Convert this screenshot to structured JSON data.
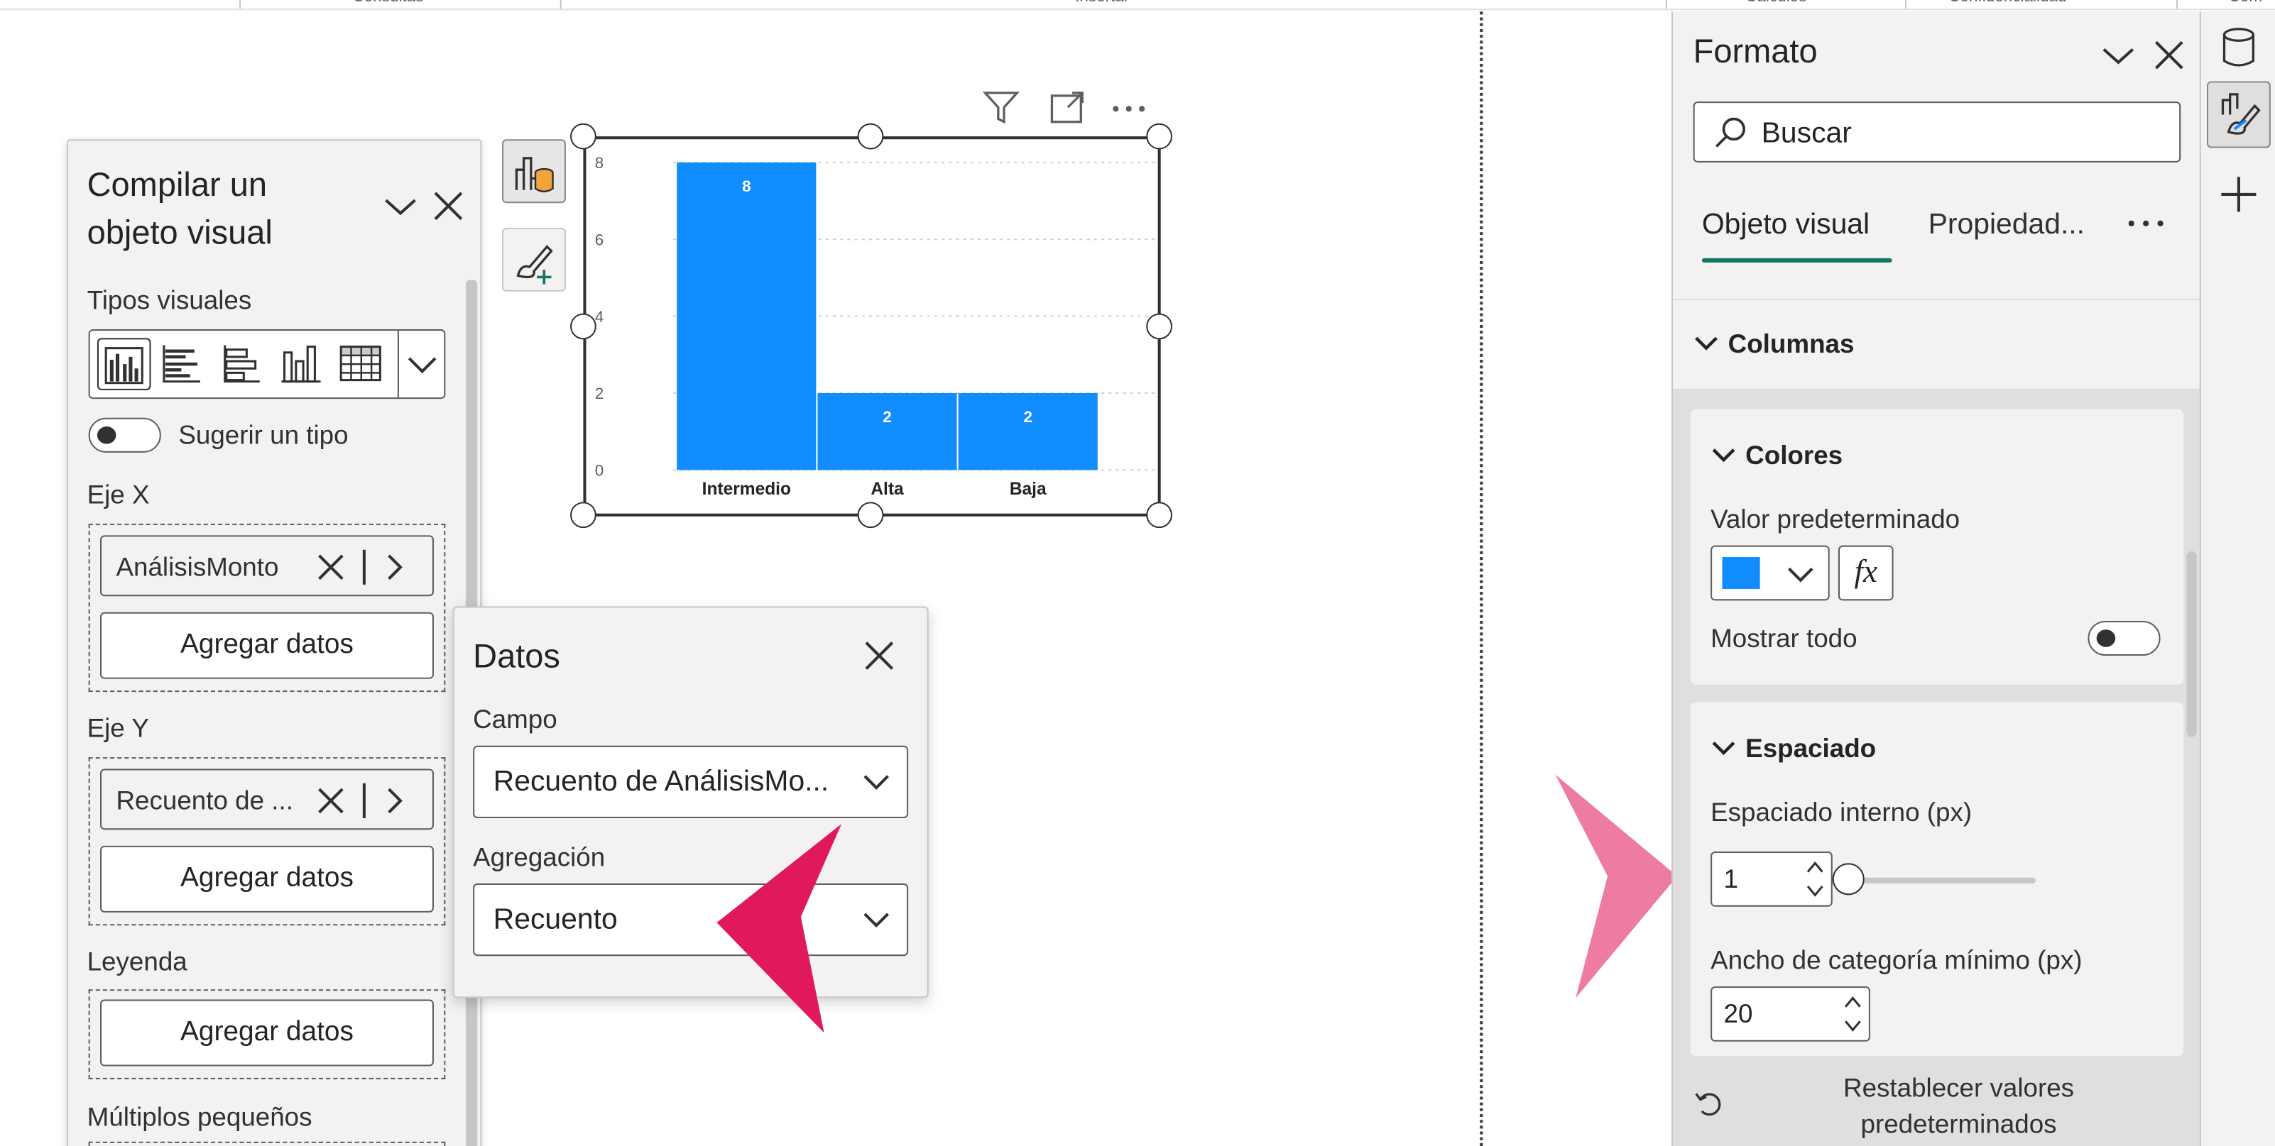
{
  "ribbon": {
    "groups": [
      "Consultas",
      "Insertar",
      "Cálculos",
      "Confidencialidad",
      "Com"
    ]
  },
  "build_pane": {
    "title": "Compilar un objeto visual",
    "visual_types_label": "Tipos visuales",
    "visual_type_icons": [
      "clustered-column-chart-icon",
      "clustered-bar-chart-icon",
      "stacked-bar-chart-icon",
      "column-chart-icon",
      "table-icon"
    ],
    "suggest_label": "Sugerir un tipo",
    "x_axis_label": "Eje X",
    "x_axis_field": "AnálisisMonto",
    "y_axis_label": "Eje Y",
    "y_axis_field": "Recuento de ...",
    "legend_label": "Leyenda",
    "small_multiples_label": "Múltiplos pequeños",
    "add_data_label": "Agregar datos"
  },
  "chart_data": {
    "type": "bar",
    "categories": [
      "Intermedio",
      "Alta",
      "Baja"
    ],
    "values": [
      8,
      2,
      2
    ],
    "ylim": [
      0,
      8
    ],
    "yticks": [
      0,
      2,
      4,
      6,
      8
    ],
    "color": "#118DFF",
    "grid": true,
    "data_labels": true
  },
  "data_popup": {
    "title": "Datos",
    "field_label": "Campo",
    "field_value": "Recuento de AnálisisMo...",
    "aggregation_label": "Agregación",
    "aggregation_value": "Recuento"
  },
  "format_pane": {
    "title": "Formato",
    "search_placeholder": "Buscar",
    "tab_visual": "Objeto visual",
    "tab_properties": "Propiedad...",
    "section_columns": "Columnas",
    "colors_header": "Colores",
    "default_value_label": "Valor predeterminado",
    "default_color": "#118DFF",
    "fx_label": "fx",
    "show_all_label": "Mostrar todo",
    "spacing_header": "Espaciado",
    "inner_padding_label": "Espaciado interno (px)",
    "inner_padding_value": "1",
    "min_category_width_label": "Ancho de categoría mínimo (px)",
    "min_category_width_value": "20",
    "reset_label": "Restablecer valores predeterminados"
  },
  "colors": {
    "accent": "#117865",
    "bar": "#118DFF",
    "arrow_dark": "#E0195E",
    "arrow_light": "#EE7BA1"
  }
}
